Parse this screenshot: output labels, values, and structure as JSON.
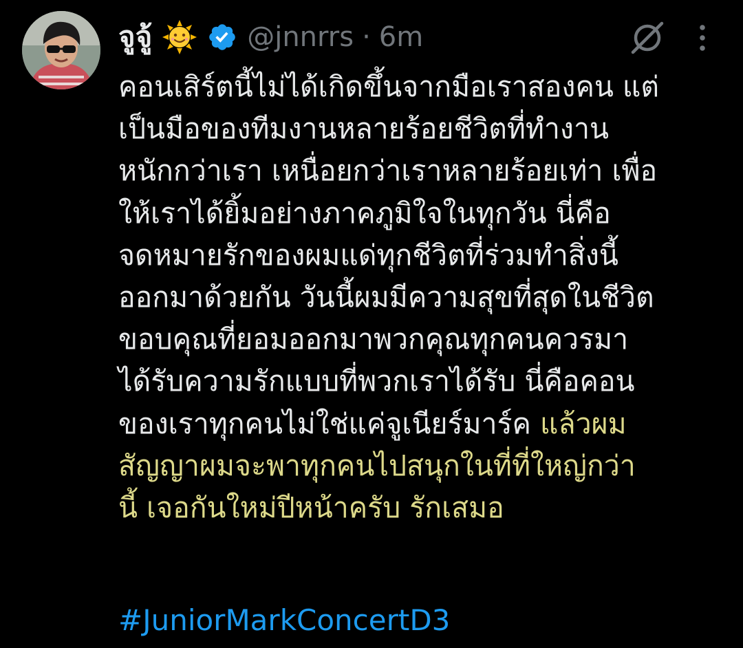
{
  "user": {
    "display_name": "จูจู้",
    "name_emoji": "sun-with-face-emoji",
    "badge": "verified-badge",
    "handle": "@jnnrrs",
    "separator": "·",
    "time": "6m"
  },
  "actions": {
    "mute_icon": "no-sign-icon",
    "more_icon": "more-vertical-icon"
  },
  "tweet": {
    "lines": [
      "คอนเสิร์ตนี้ไม่ได้เกิดขึ้นจากมือเราสองคน แต่",
      "เป็นมือของทีมงานหลายร้อยชีวิตที่ทำงาน",
      "หนักกว่าเรา เหนื่อยกว่าเราหลายร้อยเท่า เพื่อ",
      "ให้เราได้ยิ้มอย่างภาคภูมิใจในทุกวัน นี่คือ",
      "จดหมายรักของผมแด่ทุกชีวิตที่ร่วมทำสิ่งนี้",
      "ออกมาด้วยกัน วันนี้ผมมีความสุขที่สุดในชีวิต",
      "ขอบคุณที่ยอมออกมาพวกคุณทุกคนควรมา",
      "ได้รับความรักแบบที่พวกเราได้รับ นี่คือคอน"
    ],
    "line9_white": "ของเราทุกคนไม่ใช่แค่จูเนียร์มาร์ค ",
    "line9_yellow": "แล้วผม",
    "yellow_lines": [
      "สัญญาผมจะพาทุกคนไปสนุกในที่ที่ใหญ่กว่า",
      "นี้ เจอกันใหม่ปีหน้าครับ รักเสมอ"
    ],
    "hashtag": "#JuniorMarkConcertD3"
  },
  "colors": {
    "background": "#000000",
    "text": "#e7e9ea",
    "muted": "#71767b",
    "highlight": "#ddd98a",
    "link": "#1d9bf0",
    "verified": "#1d9bf0"
  }
}
